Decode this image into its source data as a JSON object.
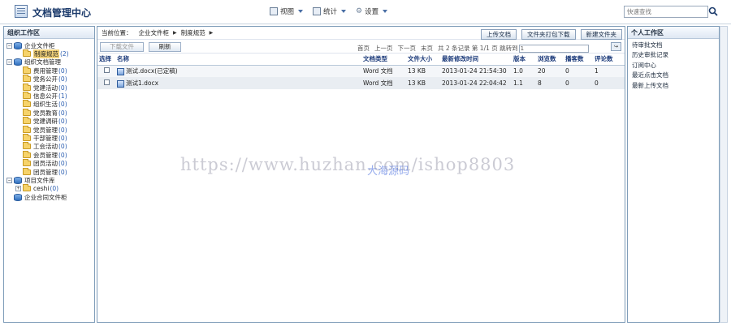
{
  "header": {
    "title": "文档管理中心",
    "menu": [
      {
        "label": "视图",
        "icon": "view-icon"
      },
      {
        "label": "统计",
        "icon": "chart-icon"
      },
      {
        "label": "设置",
        "icon": "gear-icon"
      }
    ],
    "search_placeholder": "快速查找"
  },
  "left_panel": {
    "title": "组织工作区",
    "tree": [
      {
        "label": "企业文件柜",
        "count": "",
        "level": 0,
        "toggle": "-",
        "icon": "db"
      },
      {
        "label": "制度规范",
        "count": "(2)",
        "level": 1,
        "toggle": "",
        "icon": "folder",
        "selected": true
      },
      {
        "label": "组织文档管理",
        "count": "",
        "level": 0,
        "toggle": "-",
        "icon": "db"
      },
      {
        "label": "费用管理",
        "count": "(0)",
        "level": 1,
        "toggle": "",
        "icon": "folder"
      },
      {
        "label": "党务公开",
        "count": "(0)",
        "level": 1,
        "toggle": "",
        "icon": "folder"
      },
      {
        "label": "党建活动",
        "count": "(0)",
        "level": 1,
        "toggle": "",
        "icon": "folder"
      },
      {
        "label": "信息公开",
        "count": "(1)",
        "level": 1,
        "toggle": "",
        "icon": "folder"
      },
      {
        "label": "组织生活",
        "count": "(0)",
        "level": 1,
        "toggle": "",
        "icon": "folder"
      },
      {
        "label": "党员教育",
        "count": "(0)",
        "level": 1,
        "toggle": "",
        "icon": "folder"
      },
      {
        "label": "党建调研",
        "count": "(0)",
        "level": 1,
        "toggle": "",
        "icon": "folder"
      },
      {
        "label": "党员管理",
        "count": "(0)",
        "level": 1,
        "toggle": "",
        "icon": "folder"
      },
      {
        "label": "干部管理",
        "count": "(0)",
        "level": 1,
        "toggle": "",
        "icon": "folder"
      },
      {
        "label": "工会活动",
        "count": "(0)",
        "level": 1,
        "toggle": "",
        "icon": "folder"
      },
      {
        "label": "会员管理",
        "count": "(0)",
        "level": 1,
        "toggle": "",
        "icon": "folder"
      },
      {
        "label": "团员活动",
        "count": "(0)",
        "level": 1,
        "toggle": "",
        "icon": "folder"
      },
      {
        "label": "团员管理",
        "count": "(0)",
        "level": 1,
        "toggle": "",
        "icon": "folder"
      },
      {
        "label": "项目文件库",
        "count": "",
        "level": 0,
        "toggle": "-",
        "icon": "db"
      },
      {
        "label": "ceshi",
        "count": "(0)",
        "level": 1,
        "toggle": "+",
        "icon": "folder"
      },
      {
        "label": "企业合同文件柜",
        "count": "",
        "level": 0,
        "toggle": "",
        "icon": "db"
      }
    ]
  },
  "center": {
    "breadcrumb": {
      "prefix": "当前位置：",
      "items": [
        "企业文件柜",
        "制度规范"
      ]
    },
    "top_buttons": [
      "上传文档",
      "文件夹打包下载",
      "新建文件夹"
    ],
    "toolbar": {
      "download": "下载文件",
      "refresh": "刷新"
    },
    "pager": {
      "first": "首页",
      "prev": "上一页",
      "next": "下一页",
      "last": "末页",
      "summary": "共 2 条记录 第 1/1 页 跳转到",
      "jump_value": "1"
    },
    "columns": [
      "选择",
      "名称",
      "文档类型",
      "文件大小",
      "最新修改时间",
      "版本",
      "浏览数",
      "播客数",
      "评论数"
    ],
    "rows": [
      {
        "name": "测试.docx(已定稿)",
        "type": "Word 文档",
        "size": "13 KB",
        "modified": "2013-01-24 21:54:30",
        "version": "1.0",
        "views": "20",
        "podcasts": "0",
        "comments": "1"
      },
      {
        "name": "测试1.docx",
        "type": "Word 文档",
        "size": "13 KB",
        "modified": "2013-01-24 22:04:42",
        "version": "1.1",
        "views": "8",
        "podcasts": "0",
        "comments": "0"
      }
    ]
  },
  "right_panel": {
    "title": "个人工作区",
    "links": [
      "待审批文档",
      "历史审批记录",
      "订阅中心",
      "最近点击文档",
      "最新上传文档"
    ]
  },
  "watermark": {
    "url": "https://www.huzhan.com/ishop8803",
    "text": "大海源码"
  },
  "colors": {
    "panel_border": "#7f9db9",
    "header_text": "#1b3a6b",
    "column_text": "#1b3a7a",
    "selected_bg": "#f3d27a"
  }
}
